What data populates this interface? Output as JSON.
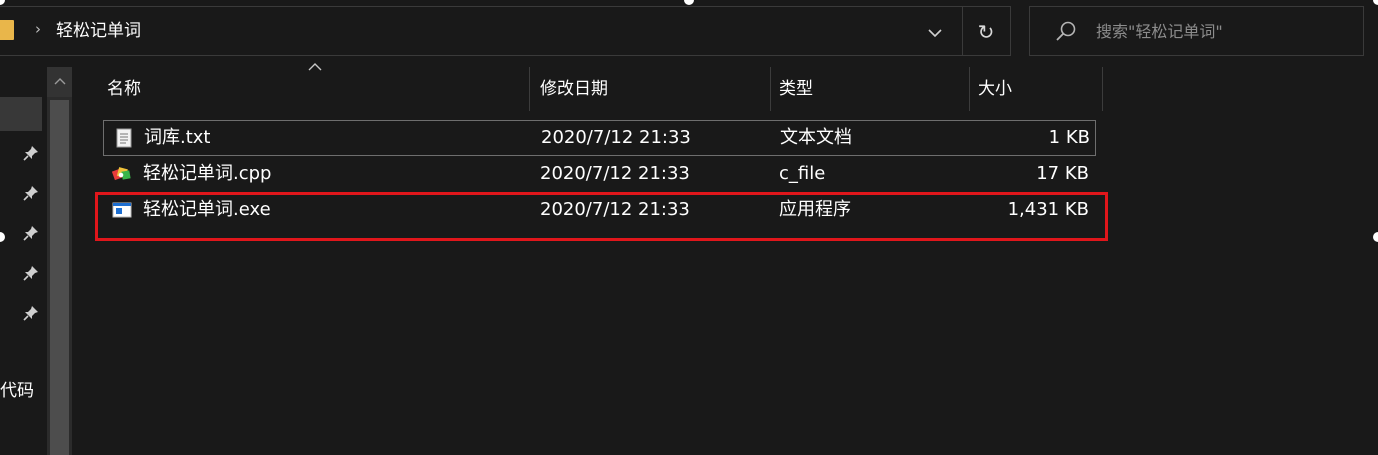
{
  "address": {
    "separator": "›",
    "breadcrumb": "轻松记单词",
    "dropdown_icon": "chevron-down-icon",
    "refresh_icon": "refresh-icon",
    "refresh_glyph": "↻",
    "dropdown_glyph": "⌄"
  },
  "search": {
    "placeholder": "搜索\"轻松记单词\""
  },
  "nav": {
    "scroll_up_glyph": "^",
    "pin_glyph": "📌",
    "visible_text": "代码"
  },
  "columns": {
    "name": "名称",
    "modified": "修改日期",
    "type": "类型",
    "size": "大小",
    "sort_glyph": "^"
  },
  "files": [
    {
      "name": "词库.txt",
      "modified": "2020/7/12 21:33",
      "type": "文本文档",
      "size": "1 KB",
      "icon": "text-file-icon"
    },
    {
      "name": "轻松记单词.cpp",
      "modified": "2020/7/12 21:33",
      "type": "c_file",
      "size": "17 KB",
      "icon": "cpp-file-icon"
    },
    {
      "name": "轻松记单词.exe",
      "modified": "2020/7/12 21:33",
      "type": "应用程序",
      "size": "1,431 KB",
      "icon": "exe-file-icon"
    }
  ],
  "colors": {
    "background": "#191919",
    "highlight_border": "#e0161b",
    "folder": "#e9b64a"
  }
}
